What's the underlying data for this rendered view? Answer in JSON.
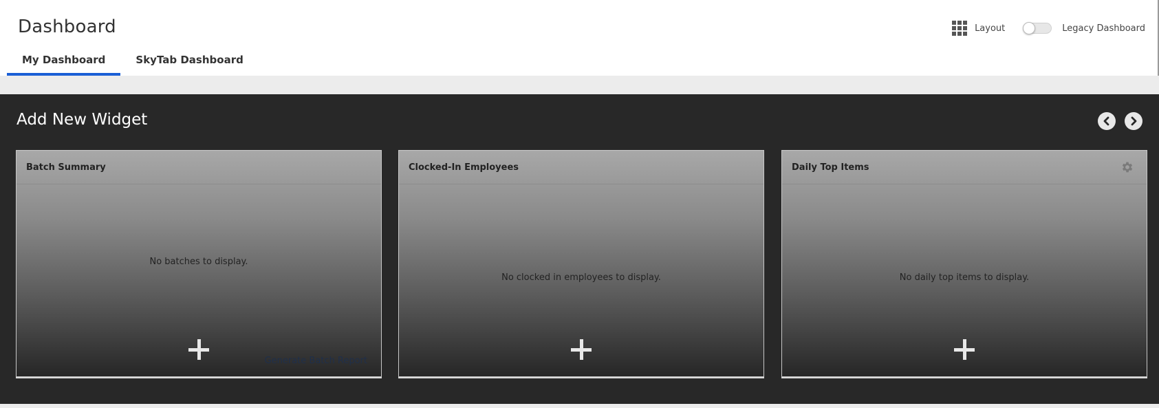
{
  "header": {
    "title": "Dashboard",
    "tabs": [
      {
        "label": "My Dashboard",
        "active": true
      },
      {
        "label": "SkyTab Dashboard",
        "active": false
      }
    ],
    "layout_label": "Layout",
    "layout_icon": "grid-icon",
    "legacy_toggle_label": "Legacy Dashboard",
    "legacy_toggle_on": false
  },
  "panel": {
    "title": "Add New Widget",
    "prev_icon": "chevron-left-icon",
    "next_icon": "chevron-right-icon"
  },
  "widgets": [
    {
      "title": "Batch Summary",
      "empty_message": "No batches to display.",
      "footer_link": "Generate Batch Report",
      "add_icon": "plus-icon"
    },
    {
      "title": "Clocked-In Employees",
      "empty_message": "No clocked in employees to display.",
      "add_icon": "plus-icon"
    },
    {
      "title": "Daily Top Items",
      "empty_message": "No daily top items to display.",
      "settings_icon": "gear-icon",
      "add_icon": "plus-icon"
    }
  ],
  "colors": {
    "accent": "#1a5fd6",
    "panel_bg": "#282828",
    "page_band": "#ececec"
  }
}
